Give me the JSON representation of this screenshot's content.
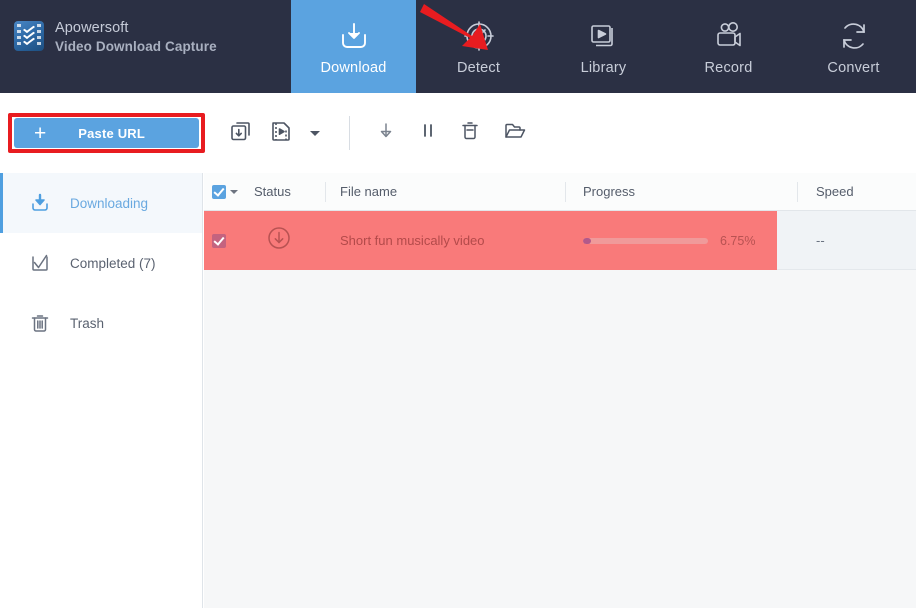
{
  "brand": {
    "name": "Apowersoft",
    "subtitle": "Video Download Capture",
    "logo_icon": "film-chevron-logo-icon"
  },
  "header": {
    "active_tab": "Download",
    "accent_color": "#5ba3e0",
    "background_color": "#2b3044",
    "nav": [
      {
        "label": "Download",
        "icon": "download-tray-icon",
        "active": true
      },
      {
        "label": "Detect",
        "icon": "radar-detect-icon",
        "active": false
      },
      {
        "label": "Library",
        "icon": "video-library-icon",
        "active": false
      },
      {
        "label": "Record",
        "icon": "video-camera-icon",
        "active": false
      },
      {
        "label": "Convert",
        "icon": "refresh-convert-icon",
        "active": false
      }
    ]
  },
  "annotations": {
    "arrow": {
      "name": "red-arrow-pointer",
      "color": "#e81c20",
      "points_to": "Detect"
    },
    "highlight_box": {
      "name": "red-highlight-box",
      "color": "#e81c20",
      "surrounds": "Paste URL"
    }
  },
  "toolbar": {
    "paste_url_label": "Paste URL",
    "paste_url_plus": "+",
    "icons": [
      {
        "name": "batch-download-icon",
        "title": "Batch download"
      },
      {
        "name": "media-file-icon",
        "title": "Media file"
      },
      {
        "name": "chevron-down-icon",
        "title": "More"
      },
      {
        "name": "start-download-icon",
        "title": "Start download"
      },
      {
        "name": "pause-icon",
        "title": "Pause"
      },
      {
        "name": "delete-trash-icon",
        "title": "Delete"
      },
      {
        "name": "open-folder-icon",
        "title": "Open folder"
      }
    ]
  },
  "sidebar": {
    "items": [
      {
        "label": "Downloading",
        "icon": "download-tray-icon",
        "active": true
      },
      {
        "label": "Completed (7)",
        "icon": "check-badge-icon",
        "active": false
      },
      {
        "label": "Trash",
        "icon": "trash-icon",
        "active": false
      }
    ]
  },
  "table": {
    "columns": [
      "Status",
      "File name",
      "Progress",
      "Speed"
    ],
    "select_all_checked": true,
    "rows": [
      {
        "checked": true,
        "status_icon": "downloading-circle-arrow-icon",
        "file_name": "Short fun musically video",
        "progress_percent": 6.75,
        "progress_label": "6.75%",
        "speed": "--",
        "selected": true,
        "selection_color": "#f97a7a"
      }
    ]
  }
}
